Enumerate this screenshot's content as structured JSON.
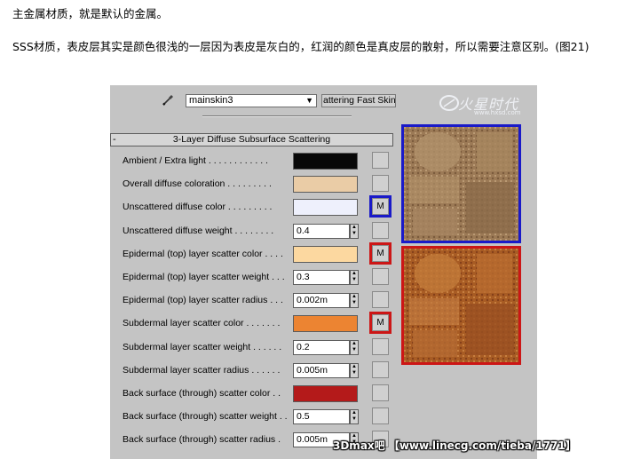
{
  "text": {
    "para1": "主金属材质，就是默认的金属。",
    "para2": "SSS材质，表皮层其实是颜色很浅的一层因为表皮是灰白的，红润的颜色是真皮层的散射，所以需要注意区别。(图21)"
  },
  "panel": {
    "material_name": "mainskin3",
    "material_type": "attering Fast Skin",
    "rollout_toggle": "-",
    "rollout_title": "3-Layer Diffuse Subsurface Scattering",
    "logo_main": "火星时代",
    "logo_sub": "www.hxsd.com",
    "map_button_label": "M",
    "rows": [
      {
        "label": "Ambient / Extra light . . . . . . . . . . . .",
        "kind": "color",
        "color": "#080808"
      },
      {
        "label": "Overall diffuse coloration . . . . . . . . .",
        "kind": "color",
        "color": "#eacca6"
      },
      {
        "label": "Unscattered diffuse color . . . . . . . . .",
        "kind": "color",
        "color": "#eef0fc",
        "map": "M",
        "highlight": "blue"
      },
      {
        "label": "Unscattered diffuse weight . . . . . . . .",
        "kind": "value",
        "value": "0.4"
      },
      {
        "label": "Epidermal (top) layer scatter color . . . .",
        "kind": "color",
        "color": "#fcd8a0",
        "map": "M",
        "highlight": "red"
      },
      {
        "label": "Epidermal (top) layer scatter weight . . .",
        "kind": "value",
        "value": "0.3"
      },
      {
        "label": "Epidermal (top) layer scatter radius . . .",
        "kind": "value",
        "value": "0.002m"
      },
      {
        "label": "Subdermal layer scatter color . . . . . . .",
        "kind": "color",
        "color": "#ec8432",
        "map": "M",
        "highlight": "red"
      },
      {
        "label": "Subdermal layer scatter weight . . . . . .",
        "kind": "value",
        "value": "0.2"
      },
      {
        "label": "Subdermal layer scatter radius . . . . . .",
        "kind": "value",
        "value": "0.005m"
      },
      {
        "label": "Back surface (through) scatter color . .",
        "kind": "color",
        "color": "#b41a1a"
      },
      {
        "label": "Back surface (through) scatter weight . .",
        "kind": "value",
        "value": "0.5"
      },
      {
        "label": "Back surface (through) scatter radius .",
        "kind": "value",
        "value": "0.005m"
      }
    ]
  },
  "watermark": "3Dmax吧 【www.linecg.com/tieba/1771】",
  "colors": {
    "panel_bg": "#c4c4c4",
    "highlight_blue": "#1a1ac8",
    "highlight_red": "#cc1616"
  }
}
